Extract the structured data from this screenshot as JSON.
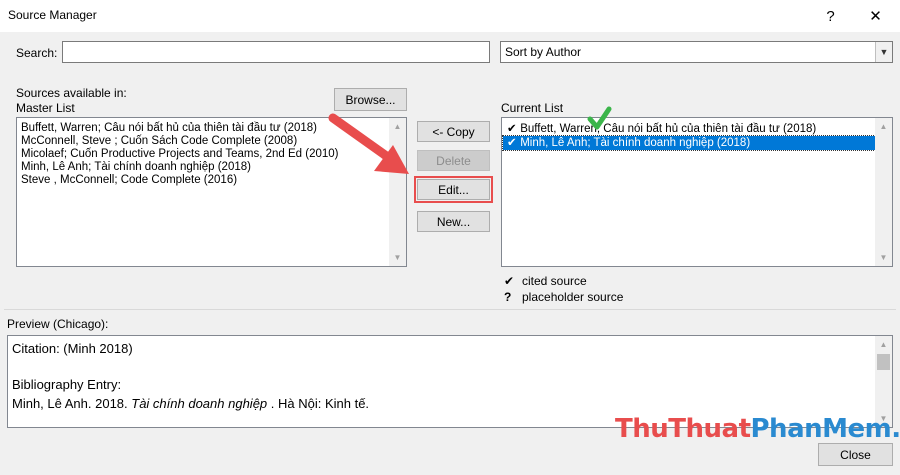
{
  "window": {
    "title": "Source Manager",
    "help": "?",
    "close": "✕"
  },
  "search": {
    "label": "Search:",
    "value": "",
    "placeholder": ""
  },
  "sort": {
    "selected": "Sort by Author"
  },
  "sources_available": {
    "label": "Sources available in:",
    "list_name": "Master List",
    "browse_label": "Browse..."
  },
  "master_list": [
    "Buffett, Warren; Câu nói bất hủ của thiên tài đầu tư (2018)",
    "McConnell, Steve ; Cuốn Sách Code Complete (2008)",
    "Micolaef; Cuốn Productive Projects and Teams, 2nd Ed (2010)",
    "Minh, Lê  Anh; Tài chính doanh nghiệp  (2018)",
    "Steve , McConnell; Code Complete (2016)"
  ],
  "buttons": {
    "copy": "<- Copy",
    "delete": "Delete",
    "edit": "Edit...",
    "new": "New..."
  },
  "current": {
    "label": "Current List",
    "items": [
      {
        "check": "✔",
        "text": "Buffett, Warren; Câu nói bất hủ của thiên tài đầu tư (2018)"
      },
      {
        "check": "✔",
        "text": "Minh, Lê  Anh; Tài chính doanh nghiệp  (2018)"
      }
    ]
  },
  "legend": {
    "cited_mark": "✔",
    "cited_label": "cited source",
    "placeholder_mark": "?",
    "placeholder_label": "placeholder source"
  },
  "preview": {
    "label": "Preview (Chicago):",
    "citation": "Citation:  (Minh 2018)",
    "bib_heading": "Bibliography Entry:",
    "bib_author": "Minh, Lê Anh. 2018. ",
    "bib_title": "Tài chính doanh nghiệp",
    "bib_rest": " . Hà Nội: Kinh tế."
  },
  "close_button": "Close",
  "watermark": {
    "part1": "Thu",
    "part2": "Thuat",
    "part3": "PhanMem",
    "part4": ".vn"
  },
  "colors": {
    "accent": "#0078d7",
    "arrow": "#e84d4d",
    "check_green": "#3bb54a"
  }
}
